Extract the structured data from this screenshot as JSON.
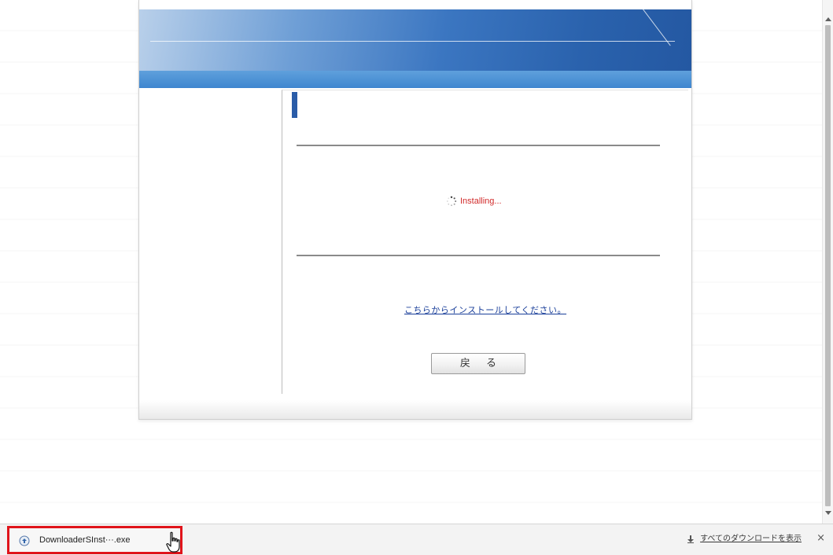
{
  "installer": {
    "status_text": "Installing...",
    "install_link": "こちらからインストールしてください。",
    "back_button_label": "戻 る"
  },
  "download_bar": {
    "file_name": "DownloaderSInst···.exe",
    "show_all_label": "すべてのダウンロードを表示",
    "close_label": "×"
  },
  "colors": {
    "header_blue": "#2a62ad",
    "status_red": "#d12a2a",
    "highlight_red": "#e0141b"
  },
  "icons": {
    "status": "spinner-icon",
    "file": "file-icon",
    "cursor": "hand-cursor-icon",
    "download": "download-arrow-icon",
    "close": "close-icon"
  }
}
